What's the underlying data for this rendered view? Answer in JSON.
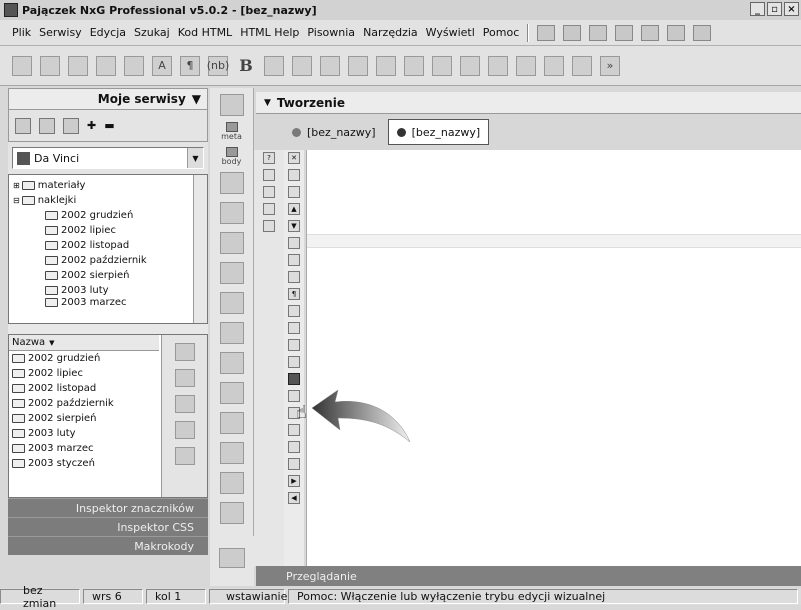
{
  "window": {
    "title": "Pajączek NxG Professional v5.0.2 - [bez_nazwy]",
    "min": "_",
    "max": "▫",
    "close": "×"
  },
  "menu": [
    "Plik",
    "Serwisy",
    "Edycja",
    "Szukaj",
    "Kod HTML",
    "HTML Help",
    "Pisownia",
    "Narzędzia",
    "Wyświetl",
    "Pomoc"
  ],
  "toolbar": {
    "tag_label": "(nb)",
    "bold_label": "B"
  },
  "left_panel": {
    "title": "Moje serwisy",
    "site_select": "Da Vinci",
    "tree": [
      "materiały",
      "naklejki",
      "2002 grudzień",
      "2002 lipiec",
      "2002 listopad",
      "2002 październik",
      "2002 sierpień",
      "2003 luty",
      "2003 marzec"
    ],
    "list_header": "Nazwa",
    "list": [
      "2002 grudzień",
      "2002 lipiec",
      "2002 listopad",
      "2002 październik",
      "2002 sierpień",
      "2003 luty",
      "2003 marzec",
      "2003 styczeń"
    ],
    "drawers": [
      "Inspektor znaczników",
      "Inspektor CSS",
      "Makrokody"
    ]
  },
  "mid_panel": {
    "meta_label": "meta",
    "body_label": "body"
  },
  "right_panel": {
    "title": "Tworzenie",
    "tabs": [
      {
        "label": "[bez_nazwy]",
        "color": "#7a7a7a"
      },
      {
        "label": "[bez_nazwy]",
        "color": "#333333"
      }
    ],
    "bottom_label": "Przeglądanie"
  },
  "status": {
    "changes": "bez zmian",
    "row": "wrs 6",
    "col": "kol 1",
    "mode": "wstawianie",
    "help": "Pomoc: Włączenie lub wyłączenie trybu edycji wizualnej"
  }
}
